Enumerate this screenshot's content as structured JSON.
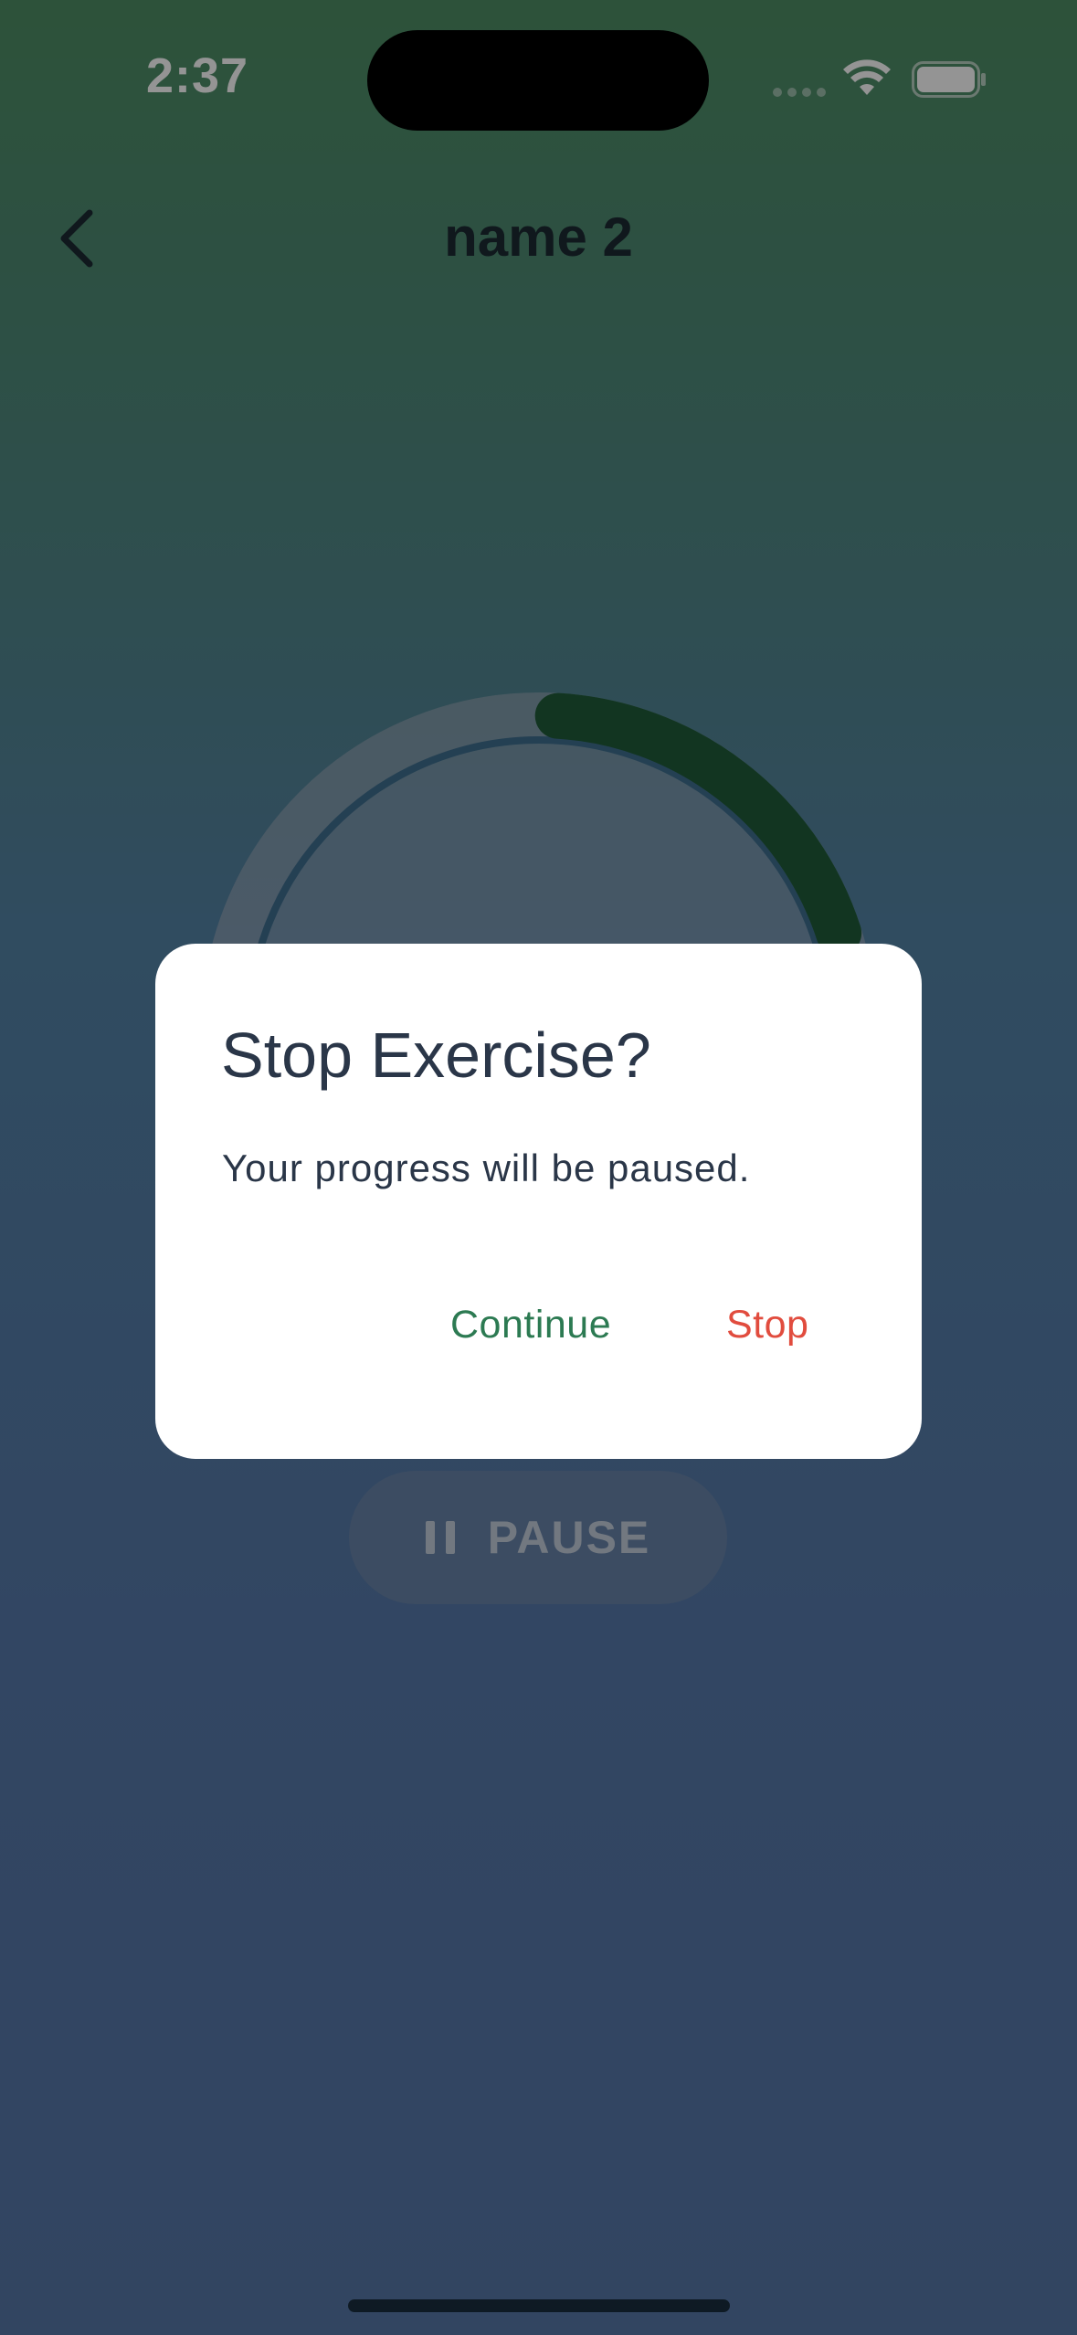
{
  "status_bar": {
    "time": "2:37"
  },
  "header": {
    "title": "name 2"
  },
  "timer": {
    "progress_fraction": 0.2
  },
  "controls": {
    "pause_label": "PAUSE"
  },
  "dialog": {
    "title": "Stop Exercise?",
    "message": "Your progress will be paused.",
    "continue_label": "Continue",
    "stop_label": "Stop"
  },
  "colors": {
    "continue": "#2c7a52",
    "stop": "#e14c3e",
    "ring_progress": "#205c3a"
  }
}
